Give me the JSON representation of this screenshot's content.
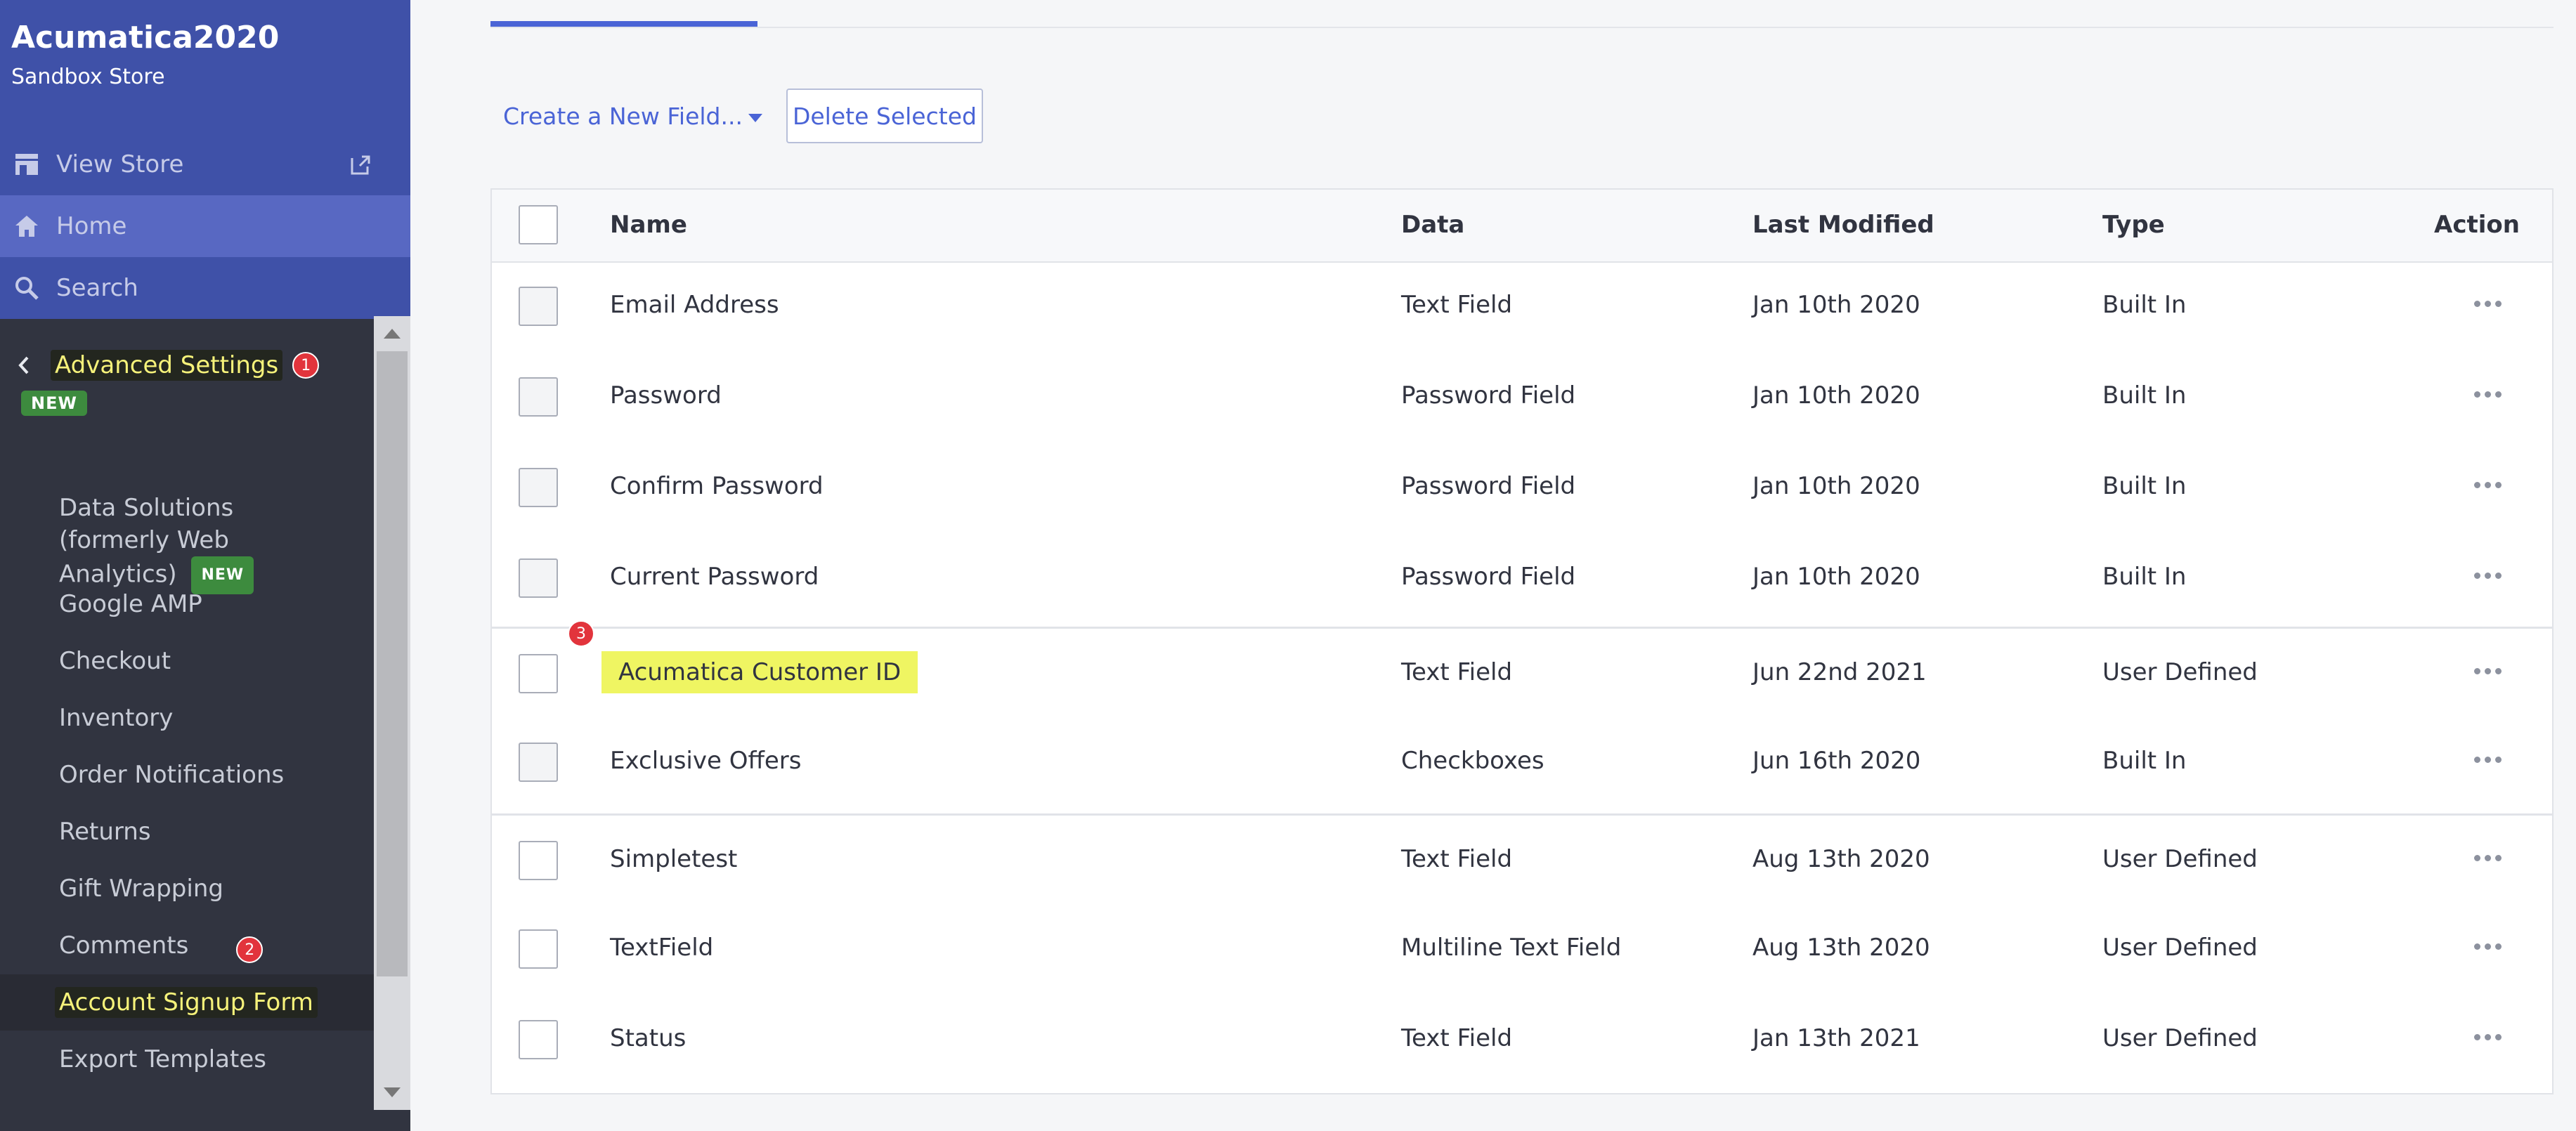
{
  "sidebar": {
    "brand_title": "Acumatica2020",
    "brand_subtitle": "Sandbox Store",
    "view_store": "View Store",
    "home": "Home",
    "search": "Search",
    "section_title": "Advanced Settings",
    "new_badge": "NEW",
    "annotations": [
      "1",
      "2"
    ],
    "items": [
      {
        "label": "Data Solutions (formerly Web Analytics)",
        "badge": "NEW"
      },
      {
        "label": "Google AMP"
      },
      {
        "label": "Checkout"
      },
      {
        "label": "Inventory"
      },
      {
        "label": "Order Notifications"
      },
      {
        "label": "Returns"
      },
      {
        "label": "Gift Wrapping"
      },
      {
        "label": "Comments"
      },
      {
        "label": "Account Signup Form",
        "active": true
      },
      {
        "label": "Export Templates"
      }
    ]
  },
  "toolbar": {
    "create_label": "Create a New Field...",
    "delete_label": "Delete Selected"
  },
  "table": {
    "columns": [
      "Name",
      "Data",
      "Last Modified",
      "Type",
      "Action"
    ],
    "annotation": "3",
    "rows": [
      {
        "name": "Email Address",
        "data": "Text Field",
        "modified": "Jan 10th 2020",
        "type": "Built In"
      },
      {
        "name": "Password",
        "data": "Password Field",
        "modified": "Jan 10th 2020",
        "type": "Built In"
      },
      {
        "name": "Confirm Password",
        "data": "Password Field",
        "modified": "Jan 10th 2020",
        "type": "Built In"
      },
      {
        "name": "Current Password",
        "data": "Password Field",
        "modified": "Jan 10th 2020",
        "type": "Built In"
      },
      {
        "name": "Acumatica Customer ID",
        "data": "Text Field",
        "modified": "Jun 22nd 2021",
        "type": "User Defined"
      },
      {
        "name": "Exclusive Offers",
        "data": "Checkboxes",
        "modified": "Jun 16th 2020",
        "type": "Built In"
      },
      {
        "name": "Simpletest",
        "data": "Text Field",
        "modified": "Aug 13th 2020",
        "type": "User Defined"
      },
      {
        "name": "TextField",
        "data": "Multiline Text Field",
        "modified": "Aug 13th 2020",
        "type": "User Defined"
      },
      {
        "name": "Status",
        "data": "Text Field",
        "modified": "Jan 13th 2021",
        "type": "User Defined"
      }
    ]
  },
  "colors": {
    "sidebar_bg": "#313440",
    "brand_blue": "#3f51a8",
    "accent": "#4a64d6",
    "highlight": "#eff562",
    "annotation_red": "#e2343c",
    "new_green": "#3d8b3e"
  }
}
